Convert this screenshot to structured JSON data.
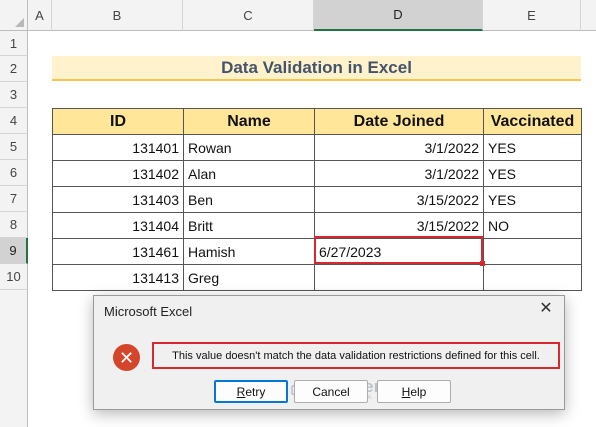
{
  "columns": [
    "A",
    "B",
    "C",
    "D",
    "E"
  ],
  "rows": [
    "1",
    "2",
    "3",
    "4",
    "5",
    "6",
    "7",
    "8",
    "9",
    "10"
  ],
  "title": "Data Validation in Excel",
  "table": {
    "headers": [
      "ID",
      "Name",
      "Date Joined",
      "Vaccinated"
    ],
    "rows": [
      [
        "131401",
        "Rowan",
        "3/1/2022",
        "YES"
      ],
      [
        "131402",
        "Alan",
        "3/1/2022",
        "YES"
      ],
      [
        "131403",
        "Ben",
        "3/15/2022",
        "YES"
      ],
      [
        "131404",
        "Britt",
        "3/15/2022",
        "NO"
      ],
      [
        "131461",
        "Hamish",
        "6/27/2023",
        ""
      ],
      [
        "131413",
        "Greg",
        "",
        ""
      ]
    ]
  },
  "dialog": {
    "title": "Microsoft Excel",
    "close_icon": "close-icon",
    "error_icon": "error-icon",
    "message": "This value doesn't match the data validation restrictions defined for this cell.",
    "buttons": {
      "retry_first": "R",
      "retry_rest": "etry",
      "cancel": "Cancel",
      "help_first": "H",
      "help_rest": "elp"
    }
  },
  "watermark": {
    "name": "exceldemy",
    "sub": "EXCEL · DATA · BI"
  },
  "colors": {
    "title_band": "#fff2cc",
    "header_fill": "#ffe699",
    "highlight": "#d9262f",
    "error_icon": "#d4462c"
  }
}
